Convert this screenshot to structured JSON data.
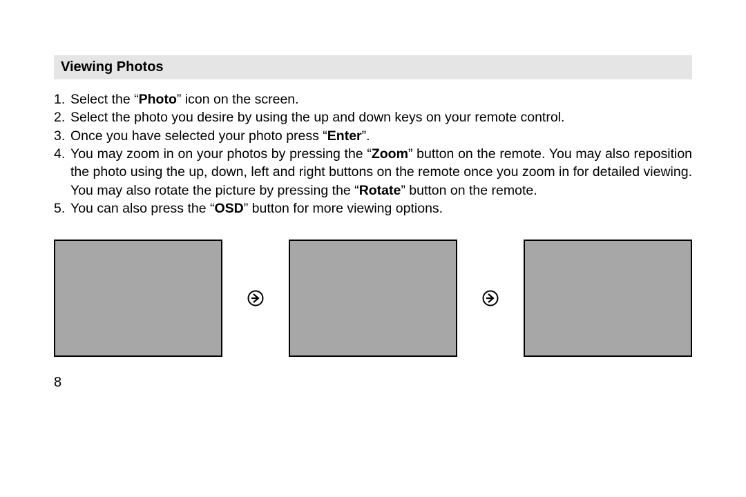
{
  "heading": "Viewing Photos",
  "steps": [
    {
      "n": "1.",
      "pre": "Select the “",
      "b1": "Photo",
      "post": "” icon on the screen."
    },
    {
      "n": "2.",
      "plain": "Select the photo you desire by using the up and down keys on your remote control."
    },
    {
      "n": "3.",
      "pre": "Once you have selected your photo press “",
      "b1": "Enter",
      "post": "”."
    },
    {
      "n": "4.",
      "pre": "You may zoom in on your photos by pressing the “",
      "b1": "Zoom",
      "mid": "” button on the remote. You may also reposition the photo using the up, down, left and right buttons on the remote once you zoom in for detailed viewing. You may also rotate the picture by pressing the “",
      "b2": "Rotate",
      "post": "” button on the remote."
    },
    {
      "n": "5.",
      "pre": "You can also press the “",
      "b1": "OSD",
      "post": "” button for more viewing options."
    }
  ],
  "page_number": "8"
}
